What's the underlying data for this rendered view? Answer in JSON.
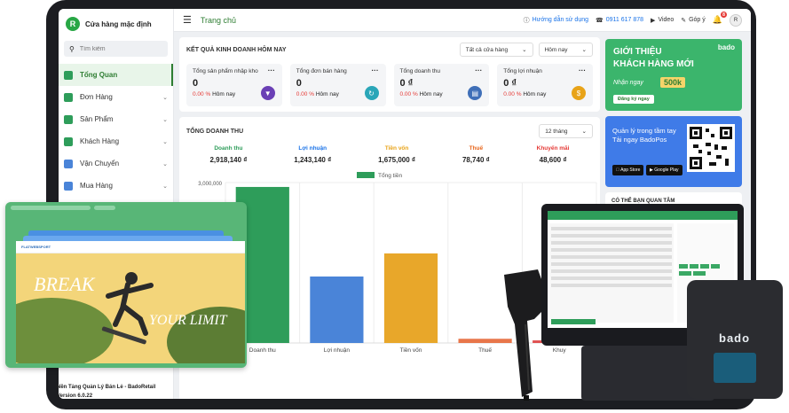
{
  "sidebar": {
    "store_initial": "R",
    "store_name": "Cửa hàng mặc định",
    "search_placeholder": "Tìm kiếm",
    "items": [
      {
        "label": "Tổng Quan",
        "icon": "dashboard-icon",
        "active": true
      },
      {
        "label": "Đơn Hàng",
        "icon": "order-icon"
      },
      {
        "label": "Sản Phẩm",
        "icon": "product-icon"
      },
      {
        "label": "Khách Hàng",
        "icon": "customer-icon"
      },
      {
        "label": "Vận Chuyển",
        "icon": "shipping-icon"
      },
      {
        "label": "Mua Hàng",
        "icon": "purchase-icon"
      }
    ]
  },
  "topbar": {
    "breadcrumb": "Trang chủ",
    "help": "Hướng dẫn sử dụng",
    "phone": "0911 617 878",
    "video": "Video",
    "feedback": "Góp ý",
    "notif_count": "8",
    "user_initial": "R"
  },
  "today": {
    "title": "KẾT QUẢ KINH DOANH HÔM NAY",
    "store_filter": "Tất cả cửa hàng",
    "date_filter": "Hôm nay",
    "cards": [
      {
        "label": "Tổng sản phẩm nhập kho",
        "value": "0",
        "change": "0.00 %",
        "suffix": "Hôm nay",
        "color": "#6a3fb5",
        "icon": "import-icon"
      },
      {
        "label": "Tổng đơn bán hàng",
        "value": "0",
        "change": "0.00 %",
        "suffix": "Hôm nay",
        "color": "#2aa6b8",
        "icon": "order-count-icon"
      },
      {
        "label": "Tổng doanh thu",
        "value": "0 ₫",
        "change": "0.00 %",
        "suffix": "Hôm nay",
        "color": "#3f6fb8",
        "icon": "revenue-icon"
      },
      {
        "label": "Tổng lợi nhuận",
        "value": "0 ₫",
        "change": "0.00 %",
        "suffix": "Hôm nay",
        "color": "#e8a318",
        "icon": "profit-icon"
      }
    ]
  },
  "revenue": {
    "title": "TỔNG DOANH THU",
    "period": "12 tháng",
    "metrics": [
      {
        "label": "Doanh thu",
        "value": "2,918,140 ₫",
        "color": "#2e9d5a"
      },
      {
        "label": "Lợi nhuận",
        "value": "1,243,140 ₫",
        "color": "#1a73e8"
      },
      {
        "label": "Tiền vốn",
        "value": "1,675,000 ₫",
        "color": "#e8a318"
      },
      {
        "label": "Thuế",
        "value": "78,740 ₫",
        "color": "#e8651a"
      },
      {
        "label": "Khuyến mãi",
        "value": "48,600 ₫",
        "color": "#e53935"
      }
    ]
  },
  "chart_data": {
    "type": "bar",
    "categories": [
      "Doanh thu",
      "Lợi nhuận",
      "Tiền vốn",
      "Thuế",
      "Khuy"
    ],
    "series": [
      {
        "name": "Tổng tiền",
        "values": [
          2918140,
          1243140,
          1675000,
          78740,
          48600
        ]
      }
    ],
    "colors": [
      "#2e9d5a",
      "#4a84d8",
      "#e8a72a",
      "#e8764a",
      "#e05050"
    ],
    "y_tick": "3,000,000",
    "ylim": [
      0,
      3000000
    ],
    "grid": true,
    "legend": "top-center"
  },
  "ads": {
    "promo_title_1": "GIỚI THIỆU",
    "promo_title_2": "KHÁCH HÀNG MỚI",
    "promo_now": "Nhận ngay",
    "promo_amount": "500k",
    "promo_button": "Đăng ký ngay",
    "brand": "bado",
    "app_line1": "Quản lý trong tầm tay",
    "app_line2": "Tải ngay BadoPos",
    "app_store": "App Store",
    "google_play": "Google Play",
    "interest_title": "CÓ THỂ BẠN QUAN TÂM"
  },
  "footer": {
    "line1": "Nền Tảng Quản Lý Bán Lẻ - BadoRetail",
    "line2": "Version 6.0.22"
  },
  "overlay": {
    "site_logo": "FLATWEBSPORT",
    "hero_text_1": "BREAK",
    "hero_text_2": "YOUR LIMIT"
  },
  "printer_brand": "bado"
}
